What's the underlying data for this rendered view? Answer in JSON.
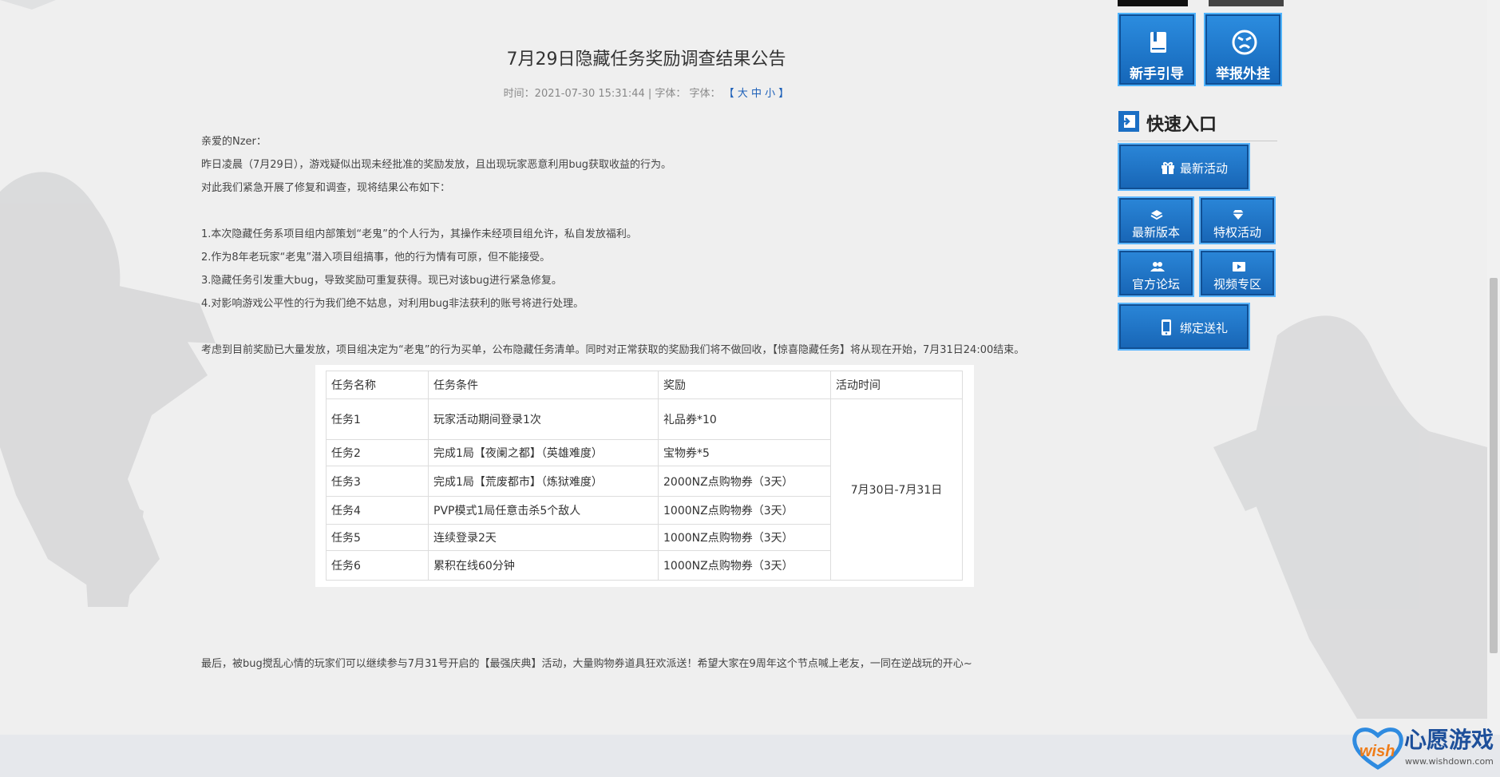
{
  "article": {
    "title": "7月29日隐藏任务奖励调查结果公告",
    "meta_prefix": "时间：2021-07-30 15:31:44 | 字体：  字体：",
    "meta_bracket_open": "【",
    "meta_bracket_close": "】",
    "font_sizes": [
      "大",
      "中",
      "小"
    ],
    "greeting": "亲爱的Nzer：",
    "intro_1": "昨日凌晨（7月29日），游戏疑似出现未经批准的奖励发放，且出现玩家恶意利用bug获取收益的行为。",
    "intro_2": "对此我们紧急开展了修复和调查，现将结果公布如下：",
    "points": [
      "1.本次隐藏任务系项目组内部策划“老鬼”的个人行为，其操作未经项目组允许，私自发放福利。",
      "2.作为8年老玩家“老鬼”潜入项目组搞事，他的行为情有可原，但不能接受。",
      "3.隐藏任务引发重大bug，导致奖励可重复获得。现已对该bug进行紧急修复。",
      "4.对影响游戏公平性的行为我们绝不姑息，对利用bug非法获利的账号将进行处理。"
    ],
    "decision": "考虑到目前奖励已大量发放，项目组决定为“老鬼”的行为买单，公布隐藏任务清单。同时对正常获取的奖励我们将不做回收，【惊喜隐藏任务】将从现在开始，7月31日24:00结束。",
    "closing": "最后，被bug搅乱心情的玩家们可以继续参与7月31号开启的【最强庆典】活动，大量购物券道具狂欢派送！希望大家在9周年这个节点喊上老友，一同在逆战玩的开心~"
  },
  "task_table": {
    "headers": [
      "任务名称",
      "任务条件",
      "奖励",
      "活动时间"
    ],
    "rows": [
      [
        "任务1",
        "玩家活动期间登录1次",
        "礼品券*10"
      ],
      [
        "任务2",
        "完成1局【夜阑之都】（英雄难度）",
        "宝物券*5"
      ],
      [
        "任务3",
        "完成1局【荒废都市】（炼狱难度）",
        "2000NZ点购物券（3天）"
      ],
      [
        "任务4",
        "PVP模式1局任意击杀5个敌人",
        "1000NZ点购物券（3天）"
      ],
      [
        "任务5",
        "连续登录2天",
        "1000NZ点购物券（3天）"
      ],
      [
        "任务6",
        "累积在线60分钟",
        "1000NZ点购物券（3天）"
      ]
    ],
    "time_span": "7月30日-7月31日"
  },
  "sidebar": {
    "newbie_guide": "新手引导",
    "report_cheat": "举报外挂",
    "quick_entry_title": "快速入口",
    "latest_events": "最新活动",
    "latest_version": "最新版本",
    "privilege_events": "特权活动",
    "official_forum": "官方论坛",
    "video_zone": "视频专区",
    "bind_gift": "绑定送礼"
  },
  "watermark": {
    "name": "心愿游戏",
    "badge": "wish",
    "url": "www.wishdown.com"
  },
  "colors": {
    "accent_blue": "#1b6fc4",
    "link_blue": "#1b5fb8",
    "background": "#efefef"
  }
}
